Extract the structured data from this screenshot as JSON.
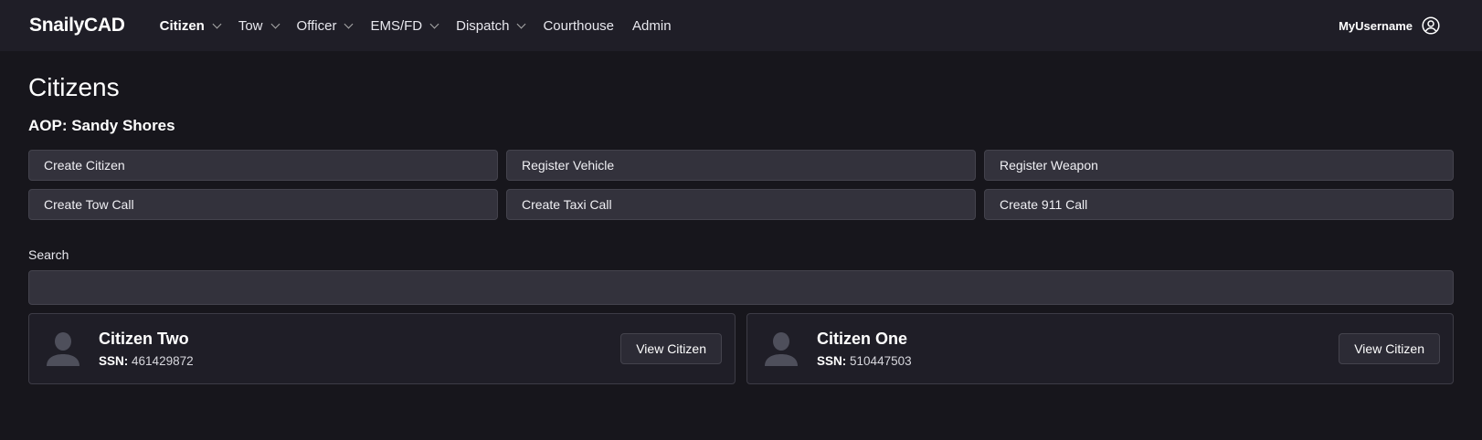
{
  "brand": "SnailyCAD",
  "nav": [
    {
      "label": "Citizen",
      "dropdown": true,
      "active": true
    },
    {
      "label": "Tow",
      "dropdown": true
    },
    {
      "label": "Officer",
      "dropdown": true
    },
    {
      "label": "EMS/FD",
      "dropdown": true
    },
    {
      "label": "Dispatch",
      "dropdown": true
    },
    {
      "label": "Courthouse",
      "dropdown": false
    },
    {
      "label": "Admin",
      "dropdown": false
    }
  ],
  "user": {
    "name": "MyUsername",
    "icon": "user-circle-icon"
  },
  "page": {
    "title": "Citizens",
    "aop": "AOP: Sandy Shores"
  },
  "actions": [
    "Create Citizen",
    "Register Vehicle",
    "Register Weapon",
    "Create Tow Call",
    "Create Taxi Call",
    "Create 911 Call"
  ],
  "search": {
    "label": "Search",
    "value": "",
    "placeholder": ""
  },
  "citizens": [
    {
      "name": "Citizen Two",
      "ssn_label": "SSN:",
      "ssn": "461429872",
      "button": "View Citizen"
    },
    {
      "name": "Citizen One",
      "ssn_label": "SSN:",
      "ssn": "510447503",
      "button": "View Citizen"
    }
  ]
}
